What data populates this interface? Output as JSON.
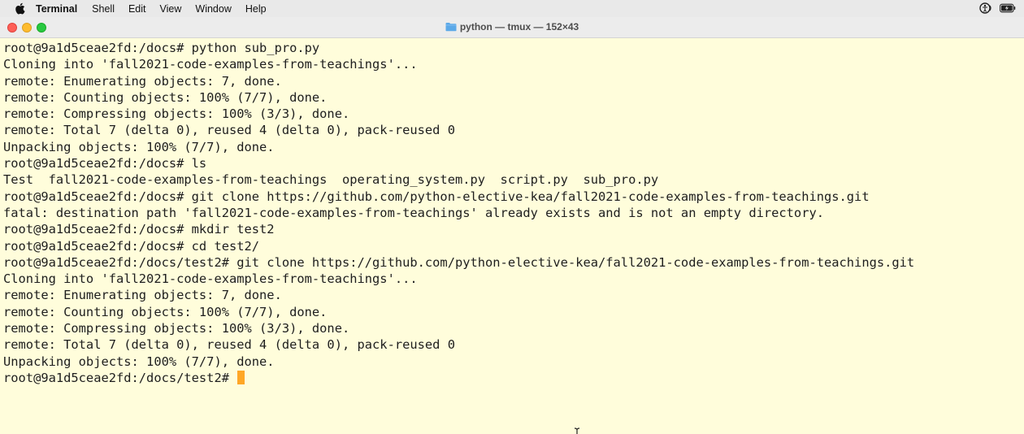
{
  "menubar": {
    "app_name": "Terminal",
    "items": [
      "Shell",
      "Edit",
      "View",
      "Window",
      "Help"
    ],
    "right_icons": [
      "accessibility-audio-icon",
      "battery-charging-icon"
    ]
  },
  "window": {
    "title": "python — tmux — 152×43",
    "title_icon": "folder-icon"
  },
  "terminal": {
    "lines": [
      "root@9a1d5ceae2fd:/docs# python sub_pro.py",
      "Cloning into 'fall2021-code-examples-from-teachings'...",
      "remote: Enumerating objects: 7, done.",
      "remote: Counting objects: 100% (7/7), done.",
      "remote: Compressing objects: 100% (3/3), done.",
      "remote: Total 7 (delta 0), reused 4 (delta 0), pack-reused 0",
      "Unpacking objects: 100% (7/7), done.",
      "root@9a1d5ceae2fd:/docs# ls",
      "Test  fall2021-code-examples-from-teachings  operating_system.py  script.py  sub_pro.py",
      "root@9a1d5ceae2fd:/docs# git clone https://github.com/python-elective-kea/fall2021-code-examples-from-teachings.git",
      "fatal: destination path 'fall2021-code-examples-from-teachings' already exists and is not an empty directory.",
      "root@9a1d5ceae2fd:/docs# mkdir test2",
      "root@9a1d5ceae2fd:/docs# cd test2/",
      "root@9a1d5ceae2fd:/docs/test2# git clone https://github.com/python-elective-kea/fall2021-code-examples-from-teachings.git",
      "Cloning into 'fall2021-code-examples-from-teachings'...",
      "remote: Enumerating objects: 7, done.",
      "remote: Counting objects: 100% (7/7), done.",
      "remote: Compressing objects: 100% (3/3), done.",
      "remote: Total 7 (delta 0), reused 4 (delta 0), pack-reused 0",
      "Unpacking objects: 100% (7/7), done."
    ],
    "prompt": "root@9a1d5ceae2fd:/docs/test2# ",
    "cursor_color": "#ffa726",
    "background_color": "#fffddb"
  }
}
